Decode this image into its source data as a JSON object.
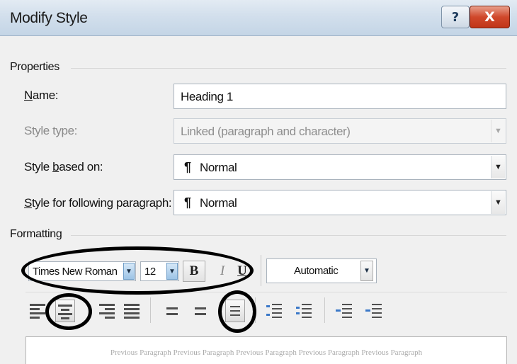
{
  "window": {
    "title": "Modify Style",
    "help_label": "?",
    "close_label": "X"
  },
  "properties": {
    "group_label": "Properties",
    "name": {
      "label_ul": "N",
      "label_rest": "ame:",
      "value": "Heading 1"
    },
    "style_type": {
      "label": "Style type:",
      "value": "Linked (paragraph and character)",
      "enabled": false
    },
    "style_based_on": {
      "label_pre": "Style ",
      "label_ul": "b",
      "label_rest": "ased on:",
      "para_mark": "¶",
      "value": "Normal"
    },
    "style_following": {
      "label_ul": "S",
      "label_rest": "tyle for following paragraph:",
      "para_mark": "¶",
      "value": "Normal"
    }
  },
  "formatting": {
    "group_label": "Formatting",
    "font": "Times New Roman",
    "size": "12",
    "bold_label": "B",
    "italic_label": "I",
    "underline_label": "U",
    "color": "Automatic",
    "bold_active": true,
    "highlighted": [
      "font-combo",
      "size-combo",
      "bold-button",
      "align-center-button",
      "single-spacing-button"
    ]
  },
  "toolbar_icons": [
    "align-left-icon",
    "align-center-icon",
    "align-right-icon",
    "justify-icon",
    "single-spacing-icon",
    "one-and-half-spacing-icon",
    "double-spacing-icon",
    "space-before-icon",
    "space-after-icon",
    "decrease-indent-icon",
    "increase-indent-icon"
  ],
  "preview": {
    "text": "Previous Paragraph Previous Paragraph Previous Paragraph Previous Paragraph Previous Paragraph"
  },
  "colors": {
    "titlebar": "#d2dfec",
    "dialog_bg": "#f0f0f0",
    "close_button": "#d0482b",
    "annotation_oval": "#000000"
  }
}
